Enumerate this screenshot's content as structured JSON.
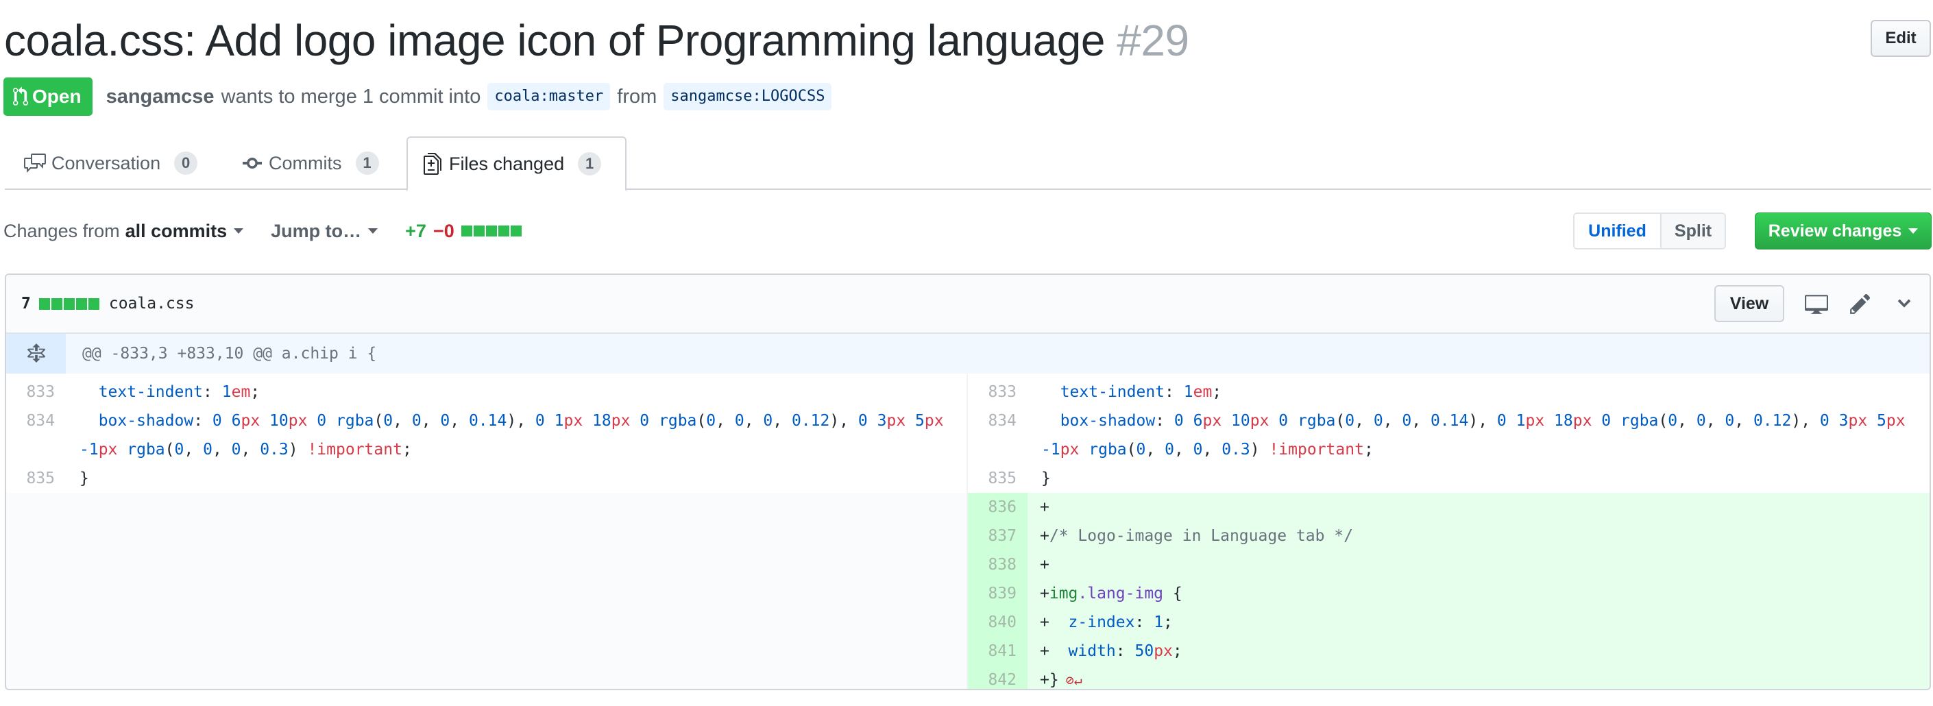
{
  "pr": {
    "title": "coala.css: Add logo image icon of Programming language",
    "number": "#29",
    "edit_label": "Edit",
    "state": "Open",
    "author": "sangamcse",
    "merge_text": "wants to merge 1 commit into",
    "base_branch": "coala:master",
    "from_text": "from",
    "head_branch": "sangamcse:LOGOCSS"
  },
  "tabs": [
    {
      "label": "Conversation",
      "count": "0",
      "icon": "comment-discussion-icon",
      "active": false
    },
    {
      "label": "Commits",
      "count": "1",
      "icon": "git-commit-icon",
      "active": false
    },
    {
      "label": "Files changed",
      "count": "1",
      "icon": "file-diff-icon",
      "active": true
    }
  ],
  "toolbar": {
    "changes_from_prefix": "Changes from",
    "changes_from_value": "all commits",
    "jump_to": "Jump to…",
    "additions": "+7",
    "deletions": "−0",
    "diffstat_blocks": {
      "added": 5,
      "total": 5
    },
    "unified_label": "Unified",
    "split_label": "Split",
    "review_label": "Review changes"
  },
  "file": {
    "change_count": "7",
    "name": "coala.css",
    "view_label": "View",
    "hunk_header": "@@ -833,3 +833,10 @@ a.chip i {",
    "left_lines": [
      {
        "num": "833",
        "code": "  text-indent: 1em;"
      },
      {
        "num": "834",
        "code": "  box-shadow: 0 6px 10px 0 rgba(0, 0, 0, 0.14), 0 1px 18px 0 rgba(0, 0, 0, 0.12), 0 3px 5px -1px rgba(0, 0, 0, 0.3) !important;"
      },
      {
        "num": "835",
        "code": "}"
      }
    ],
    "right_lines": [
      {
        "num": "833",
        "code": "  text-indent: 1em;",
        "type": "context"
      },
      {
        "num": "834",
        "code": "  box-shadow: 0 6px 10px 0 rgba(0, 0, 0, 0.14), 0 1px 18px 0 rgba(0, 0, 0, 0.12), 0 3px 5px -1px rgba(0, 0, 0, 0.3) !important;",
        "type": "context"
      },
      {
        "num": "835",
        "code": "}",
        "type": "context"
      },
      {
        "num": "836",
        "code": "+",
        "type": "addition"
      },
      {
        "num": "837",
        "code": "+/* Logo-image in Language tab */",
        "type": "addition"
      },
      {
        "num": "838",
        "code": "+",
        "type": "addition"
      },
      {
        "num": "839",
        "code": "+img.lang-img {",
        "type": "addition"
      },
      {
        "num": "840",
        "code": "+  z-index: 1;",
        "type": "addition"
      },
      {
        "num": "841",
        "code": "+  width: 50px;",
        "type": "addition"
      },
      {
        "num": "842",
        "code": "+}",
        "type": "addition",
        "no_newline_marker": "⊘↵"
      }
    ]
  },
  "colors": {
    "open_badge": "#2cbe4e",
    "addition_bg": "#e6ffed",
    "addition_gutter": "#cdffd8",
    "hunk_bg": "#f1f8ff",
    "accent": "#0366d6"
  }
}
